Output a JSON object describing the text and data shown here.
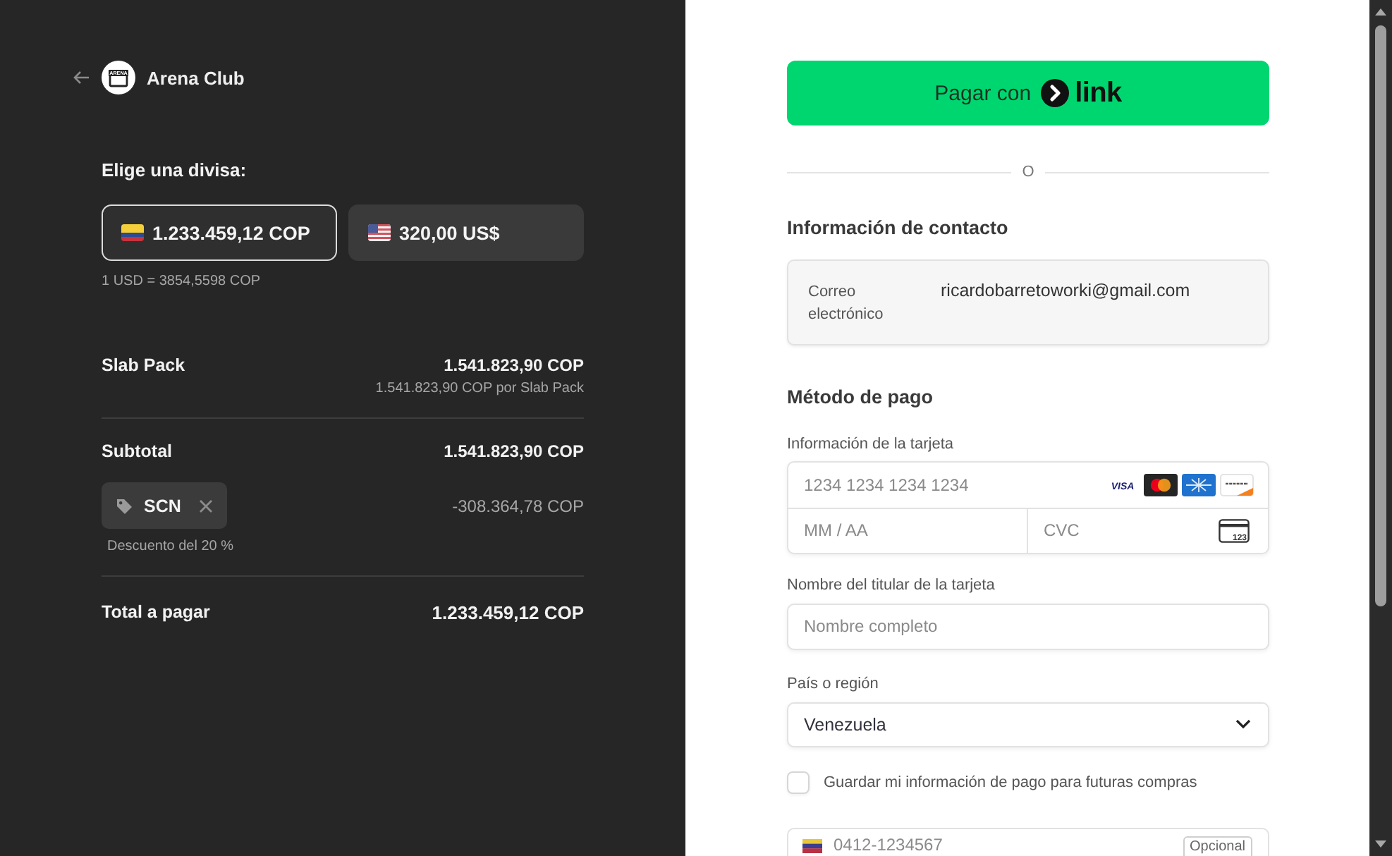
{
  "header": {
    "brand": "Arena Club",
    "logo_text": "ARENA"
  },
  "currency": {
    "title": "Elige una divisa:",
    "options": [
      {
        "kind": "cop",
        "amount": "1.233.459,12 COP",
        "selected": true
      },
      {
        "kind": "usd",
        "amount": "320,00 US$",
        "selected": false
      }
    ],
    "rate": "1 USD = 3854,5598 COP"
  },
  "summary": {
    "items": [
      {
        "name": "Slab Pack",
        "price": "1.541.823,90 COP",
        "unit_price": "1.541.823,90 COP por Slab Pack"
      }
    ],
    "subtotal": {
      "label": "Subtotal",
      "value": "1.541.823,90 COP"
    },
    "discount": {
      "code": "SCN",
      "amount": "-308.364,78 COP",
      "note": "Descuento del 20 %"
    },
    "total": {
      "label": "Total a pagar",
      "value": "1.233.459,12 COP"
    }
  },
  "link_button": {
    "label": "Pagar con",
    "brand": "link"
  },
  "divider_text": "O",
  "contact": {
    "title": "Información de contacto",
    "email_label": "Correo electrónico",
    "email": "ricardobarretoworki@gmail.com"
  },
  "payment": {
    "title": "Método de pago",
    "card": {
      "label": "Información de la tarjeta",
      "number_placeholder": "1234 1234 1234 1234",
      "brands": [
        {
          "kind": "visa",
          "label": "VISA"
        },
        {
          "kind": "mastercard"
        },
        {
          "kind": "amex"
        },
        {
          "kind": "discover"
        }
      ],
      "expiry_placeholder": "MM / AA",
      "cvc_placeholder": "CVC",
      "cvc_hint": "123"
    },
    "cardholder": {
      "label": "Nombre del titular de la tarjeta",
      "placeholder": "Nombre completo"
    },
    "country": {
      "label": "País o región",
      "value": "Venezuela"
    },
    "save_info": {
      "label": "Guardar mi información de pago para futuras compras",
      "checked": false
    },
    "phone": {
      "placeholder": "0412-1234567",
      "badge": "Opcional"
    }
  }
}
